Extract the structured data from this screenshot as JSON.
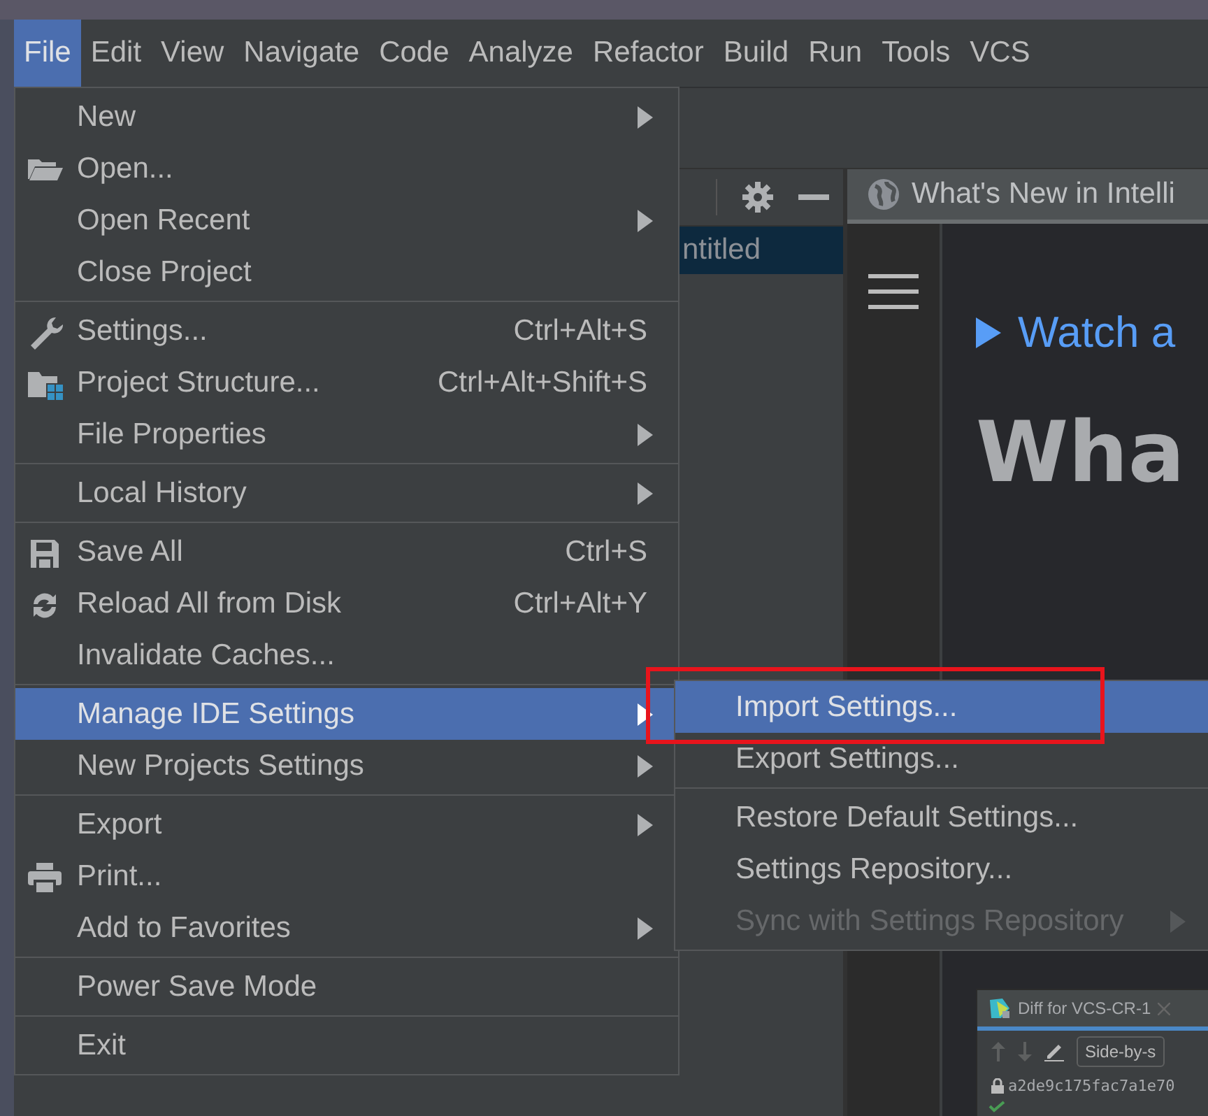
{
  "menu_bar": [
    {
      "label": "File",
      "selected": true
    },
    {
      "label": "Edit",
      "selected": false
    },
    {
      "label": "View",
      "selected": false
    },
    {
      "label": "Navigate",
      "selected": false
    },
    {
      "label": "Code",
      "selected": false
    },
    {
      "label": "Analyze",
      "selected": false
    },
    {
      "label": "Refactor",
      "selected": false
    },
    {
      "label": "Build",
      "selected": false
    },
    {
      "label": "Run",
      "selected": false
    },
    {
      "label": "Tools",
      "selected": false
    },
    {
      "label": "VCS",
      "selected": false
    }
  ],
  "file_menu": [
    {
      "kind": "item",
      "label": "New",
      "submenu": true,
      "selected": false
    },
    {
      "kind": "item",
      "label": "Open...",
      "submenu": false,
      "selected": false
    },
    {
      "kind": "item",
      "label": "Open Recent",
      "submenu": true,
      "selected": false
    },
    {
      "kind": "item",
      "label": "Close Project",
      "submenu": false,
      "selected": false
    },
    {
      "kind": "separator"
    },
    {
      "kind": "item",
      "label": "Settings...",
      "shortcut": "Ctrl+Alt+S",
      "submenu": false,
      "selected": false
    },
    {
      "kind": "item",
      "label": "Project Structure...",
      "shortcut": "Ctrl+Alt+Shift+S",
      "submenu": false,
      "selected": false
    },
    {
      "kind": "item",
      "label": "File Properties",
      "submenu": true,
      "selected": false
    },
    {
      "kind": "separator"
    },
    {
      "kind": "item",
      "label": "Local History",
      "submenu": true,
      "selected": false
    },
    {
      "kind": "separator"
    },
    {
      "kind": "item",
      "label": "Save All",
      "shortcut": "Ctrl+S",
      "submenu": false,
      "selected": false
    },
    {
      "kind": "item",
      "label": "Reload All from Disk",
      "shortcut": "Ctrl+Alt+Y",
      "submenu": false,
      "selected": false
    },
    {
      "kind": "item",
      "label": "Invalidate Caches...",
      "submenu": false,
      "selected": false
    },
    {
      "kind": "separator"
    },
    {
      "kind": "item",
      "label": "Manage IDE Settings",
      "submenu": true,
      "selected": true
    },
    {
      "kind": "item",
      "label": "New Projects Settings",
      "submenu": true,
      "selected": false
    },
    {
      "kind": "separator"
    },
    {
      "kind": "item",
      "label": "Export",
      "submenu": true,
      "selected": false
    },
    {
      "kind": "item",
      "label": "Print...",
      "submenu": false,
      "selected": false
    },
    {
      "kind": "item",
      "label": "Add to Favorites",
      "submenu": true,
      "selected": false
    },
    {
      "kind": "separator"
    },
    {
      "kind": "item",
      "label": "Power Save Mode",
      "submenu": false,
      "selected": false
    },
    {
      "kind": "separator"
    },
    {
      "kind": "item",
      "label": "Exit",
      "submenu": false,
      "selected": false
    }
  ],
  "submenu": [
    {
      "kind": "item",
      "label": "Import Settings...",
      "submenu": false,
      "selected": true,
      "disabled": false,
      "annotated": true
    },
    {
      "kind": "item",
      "label": "Export Settings...",
      "submenu": false,
      "selected": false,
      "disabled": false,
      "annotated": false
    },
    {
      "kind": "separator"
    },
    {
      "kind": "item",
      "label": "Restore Default Settings...",
      "submenu": false,
      "selected": false,
      "disabled": false,
      "annotated": false
    },
    {
      "kind": "item",
      "label": "Settings Repository...",
      "submenu": false,
      "selected": false,
      "disabled": false,
      "annotated": false
    },
    {
      "kind": "item",
      "label": "Sync with Settings Repository",
      "submenu": true,
      "selected": false,
      "disabled": true,
      "annotated": false
    }
  ],
  "project_panel": {
    "row": {
      "label": "ntitled",
      "selected": true
    }
  },
  "editor": {
    "tab": {
      "title": "What's New in Intelli"
    },
    "link": "Watch a",
    "heading": "Wha"
  },
  "diff_window": {
    "tab": {
      "title": "Diff for VCS-CR-1"
    },
    "mode_button": "Side-by-s",
    "revision": "a2de9c175fac7a1e70"
  }
}
